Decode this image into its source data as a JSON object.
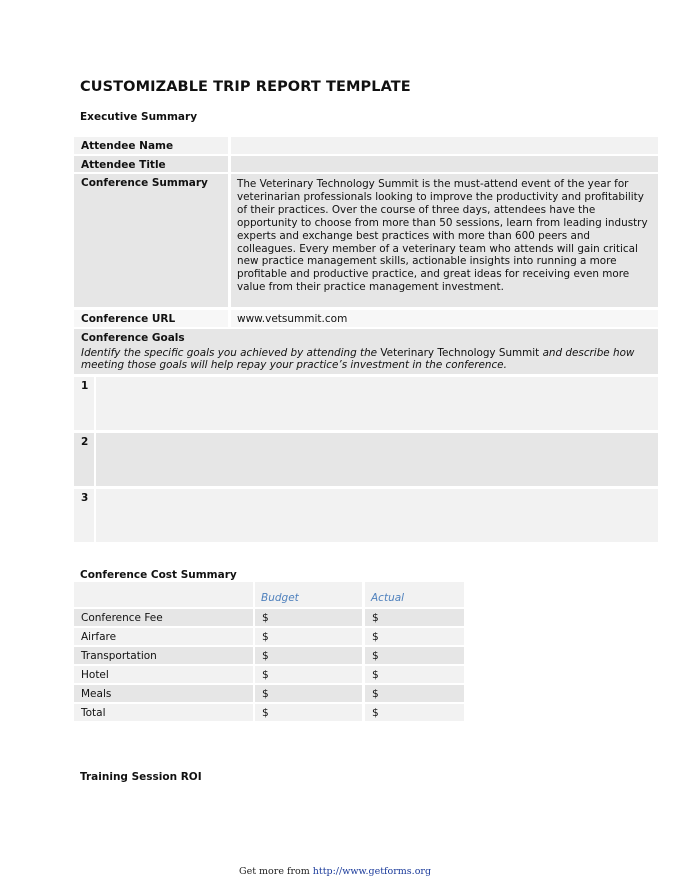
{
  "document": {
    "title": "CUSTOMIZABLE TRIP REPORT TEMPLATE",
    "executive_summary_heading": "Executive Summary",
    "fields": {
      "attendee_name_label": "Attendee Name",
      "attendee_name_value": "",
      "attendee_title_label": "Attendee Title",
      "attendee_title_value": "",
      "conference_summary_label": "Conference Summary",
      "conference_summary_value": "The Veterinary Technology Summit is the must-attend event of the year for veterinarian professionals looking to improve the productivity and profitability of their practices. Over the course of three days, attendees have the opportunity to choose from more than 50 sessions, learn from leading industry experts and exchange best practices with more than 600 peers and colleagues. Every member of a veterinary team who attends will gain critical new practice management skills, actionable insights into running a more profitable and productive practice, and great ideas for receiving even more value from their practice management investment.",
      "conference_url_label": "Conference URL",
      "conference_url_value": "www.vetsummit.com"
    },
    "goals": {
      "heading": "Conference Goals",
      "desc_part1": "Identify the specific goals you achieved by attending the ",
      "desc_part2": "Veterinary Technology Summit",
      "desc_part3": " and describe how meeting those goals will help repay your practice’s investment in the conference.",
      "items": [
        {
          "number": "1",
          "value": ""
        },
        {
          "number": "2",
          "value": ""
        },
        {
          "number": "3",
          "value": ""
        }
      ]
    },
    "cost_summary": {
      "heading": "Conference Cost Summary",
      "columns": [
        "",
        "Budget",
        "Actual"
      ],
      "rows": [
        {
          "item": "Conference Fee",
          "budget": "$",
          "actual": "$"
        },
        {
          "item": "Airfare",
          "budget": "$",
          "actual": "$"
        },
        {
          "item": "Transportation",
          "budget": "$",
          "actual": "$"
        },
        {
          "item": "Hotel",
          "budget": "$",
          "actual": "$"
        },
        {
          "item": "Meals",
          "budget": "$",
          "actual": "$"
        },
        {
          "item": "Total",
          "budget": "$",
          "actual": "$"
        }
      ]
    },
    "training_roi_heading": "Training Session ROI"
  },
  "footer": {
    "prefix": "Get more from ",
    "link": "http://www.getforms.org"
  },
  "colors": {
    "accent": "#4f81bd",
    "cell_light": "#f2f2f2",
    "cell_mid": "#e6e6e6"
  }
}
